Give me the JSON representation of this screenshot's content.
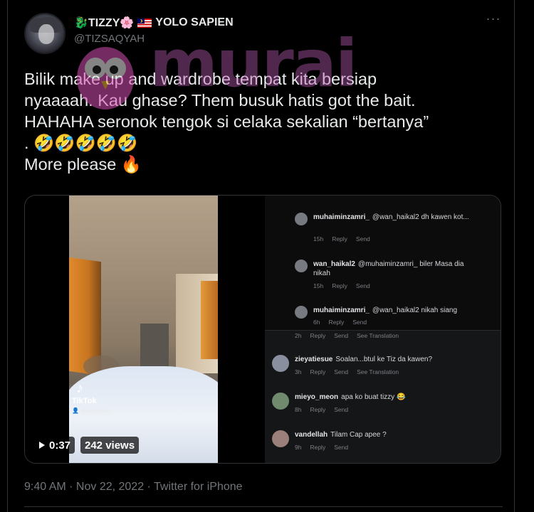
{
  "user": {
    "display_name_prefix": "🐉TIZZY🌸",
    "display_name_suffix": "YOLO SAPIEN",
    "handle": "@TIZSAQYAH"
  },
  "menu": {
    "more_label": "···"
  },
  "tweet": {
    "lines": [
      "Bilik make up and wardrobe tempat kita bersiap",
      "nyaaaah. Kau ghase? Them busuk hatis got the bait.",
      "HAHAHA seronok tengok si celaka sekalian “bertanya”",
      ". 🤣🤣🤣🤣🤣",
      "More please 🔥"
    ]
  },
  "video": {
    "duration": "0:37",
    "views": "242 views",
    "tiktok_logo": "♪",
    "tiktok_label": "TikTok",
    "tiktok_handle": "👤 @tizsaqyah"
  },
  "comments": [
    {
      "user": "muhaiminzamri_",
      "text": "@wan_haikal2 dh kawen kot...",
      "time": "15h",
      "reply": "Reply",
      "send": "Send",
      "translation": ""
    },
    {
      "user": "wan_haikal2",
      "text": "@muhaiminzamri_ biler Masa dia nikah",
      "time": "15h",
      "reply": "Reply",
      "send": "Send",
      "translation": ""
    },
    {
      "user": "muhaiminzamri_",
      "text": "@wan_haikal2 nikah siang",
      "time": "6h",
      "reply": "Reply",
      "send": "Send",
      "translation": ""
    },
    {
      "user": "",
      "text": "",
      "time": "2h",
      "reply": "Reply",
      "send": "Send",
      "translation": "See Translation"
    },
    {
      "user": "zieyatiesue",
      "text": "Soalan...btul ke Tiz da kawen?",
      "time": "3h",
      "reply": "Reply",
      "send": "Send",
      "translation": "See Translation"
    },
    {
      "user": "mieyo_meon",
      "text": "apa ko buat tizzy 😂",
      "time": "8h",
      "reply": "Reply",
      "send": "Send",
      "translation": ""
    },
    {
      "user": "vandellah",
      "text": "Tilam Cap apee ?",
      "time": "9h",
      "reply": "Reply",
      "send": "Send",
      "translation": ""
    }
  ],
  "heart_icon": "♡",
  "footer": {
    "timestamp": "9:40 AM · Nov 22, 2022 · Twitter for iPhone"
  },
  "watermark": {
    "text": "murai"
  },
  "colors": {
    "background": "#000000",
    "text_primary": "#e7e9ea",
    "text_secondary": "#71767b",
    "watermark": "#c060b8"
  }
}
